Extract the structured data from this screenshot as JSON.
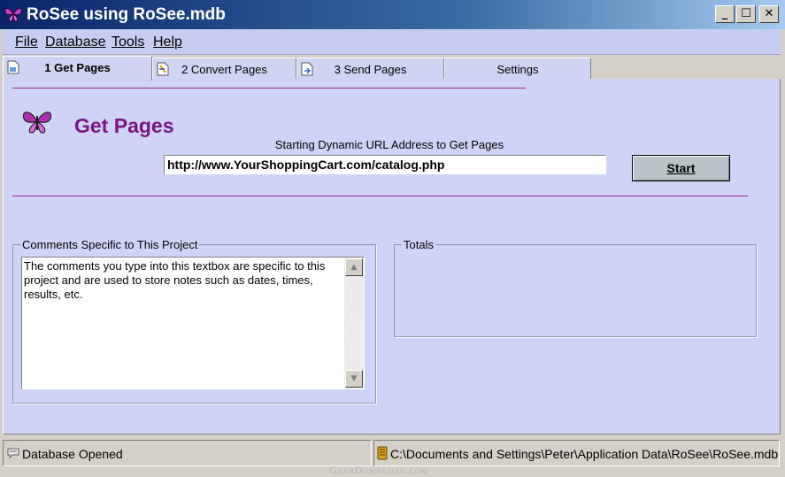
{
  "window": {
    "title": "RoSee using RoSee.mdb",
    "controls": {
      "minimize": "_",
      "maximize": "☐",
      "close": "✕"
    }
  },
  "menu": [
    "File",
    "Database",
    "Tools",
    "Help"
  ],
  "tabs": [
    {
      "label": "1 Get Pages",
      "icon": "page-icon",
      "active": true
    },
    {
      "label": "2 Convert Pages",
      "icon": "convert-icon",
      "active": false
    },
    {
      "label": "3 Send Pages",
      "icon": "send-icon",
      "active": false
    },
    {
      "label": "Settings",
      "icon": "",
      "active": false
    }
  ],
  "get_pages": {
    "heading": "Get Pages",
    "url_caption": "Starting Dynamic URL Address to Get Pages",
    "url_value": "http://www.YourShoppingCart.com/catalog.php",
    "start_label": "Start"
  },
  "comments": {
    "legend": "Comments Specific to This Project",
    "text": "The comments you type into this textbox are specific to this project and are used to store notes such as dates, times, results, etc."
  },
  "totals": {
    "legend": "Totals"
  },
  "status": {
    "left": "Database Opened",
    "right": "C:\\Documents and Settings\\Peter\\Application Data\\RoSee\\RoSee.mdb"
  },
  "watermark": "GearDownload.com",
  "colors": {
    "accent": "#7a1680",
    "panel": "#cfd4f6",
    "titlebar": "#0a246a"
  }
}
